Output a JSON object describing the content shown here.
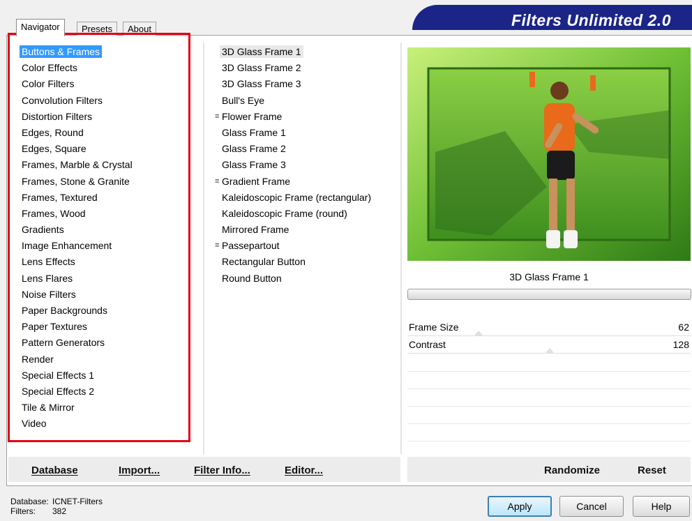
{
  "banner": {
    "title": "Filters Unlimited 2.0"
  },
  "tabs": [
    {
      "label": "Navigator"
    },
    {
      "label": "Presets"
    },
    {
      "label": "About"
    }
  ],
  "categories": [
    "Buttons & Frames",
    "Color Effects",
    "Color Filters",
    "Convolution Filters",
    "Distortion Filters",
    "Edges, Round",
    "Edges, Square",
    "Frames, Marble & Crystal",
    "Frames, Stone & Granite",
    "Frames, Textured",
    "Frames, Wood",
    "Gradients",
    "Image Enhancement",
    "Lens Effects",
    "Lens Flares",
    "Noise Filters",
    "Paper Backgrounds",
    "Paper Textures",
    "Pattern Generators",
    "Render",
    "Special Effects 1",
    "Special Effects 2",
    "Tile & Mirror",
    "Video"
  ],
  "selected_category": "Buttons & Frames",
  "filters": [
    "3D Glass Frame 1",
    "3D Glass Frame 2",
    "3D Glass Frame 3",
    "Bull's Eye",
    "Flower Frame",
    "Glass Frame 1",
    "Glass Frame 2",
    "Glass Frame 3",
    "Gradient Frame",
    "Kaleidoscopic Frame (rectangular)",
    "Kaleidoscopic Frame (round)",
    "Mirrored Frame",
    "Passepartout",
    "Rectangular Button",
    "Round Button"
  ],
  "selected_filter": "3D Glass Frame 1",
  "preview": {
    "filter_name": "3D Glass Frame 1"
  },
  "parameters": [
    {
      "label": "Frame Size",
      "value": "62",
      "fraction": 0.243
    },
    {
      "label": "Contrast",
      "value": "128",
      "fraction": 0.502
    }
  ],
  "links": {
    "database": "Database",
    "import": "Import...",
    "filter_info": "Filter Info...",
    "editor": "Editor...",
    "randomize": "Randomize",
    "reset": "Reset"
  },
  "status": {
    "database_label": "Database:",
    "database_value": "ICNET-Filters",
    "filters_label": "Filters:",
    "filters_value": "382"
  },
  "buttons": {
    "apply": "Apply",
    "cancel": "Cancel",
    "help": "Help"
  },
  "colors": {
    "banner": "#1b2587",
    "selection": "#3399ff",
    "highlight_box": "#e3000f"
  }
}
